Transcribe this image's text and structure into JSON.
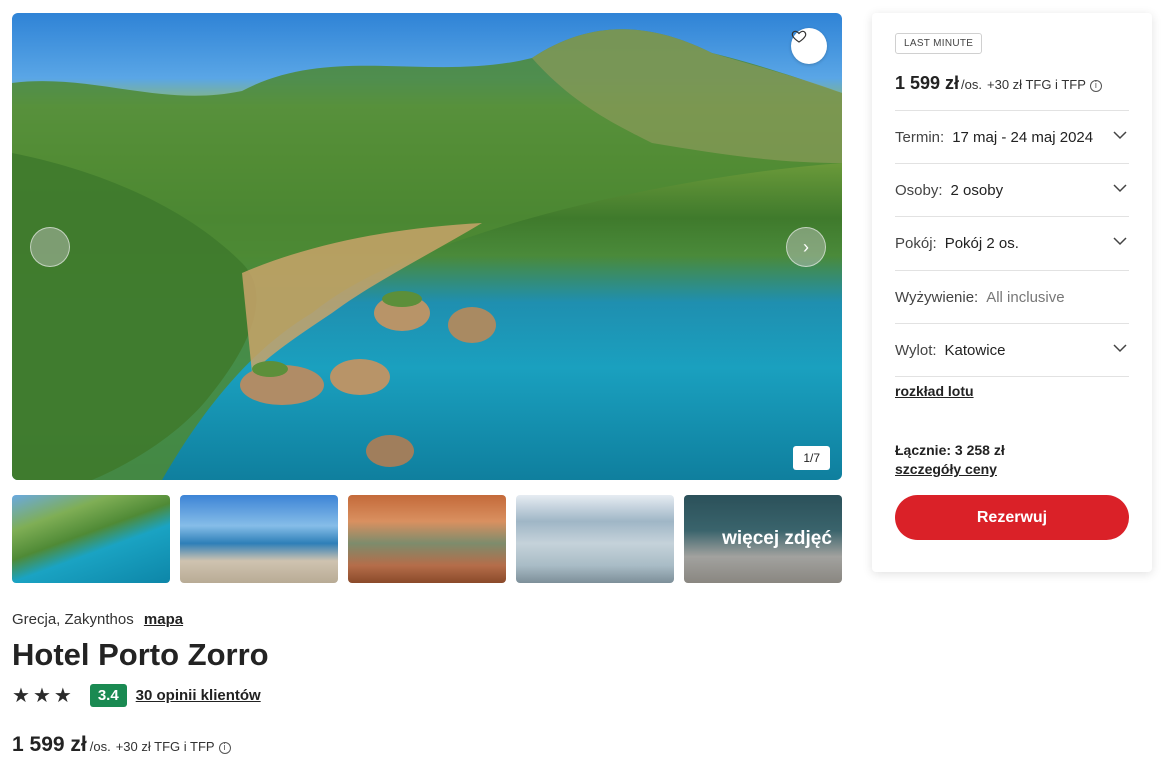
{
  "gallery": {
    "counter": "1/7",
    "more_photos_label": "więcej zdjęć"
  },
  "hotel": {
    "location": "Grecja, Zakynthos",
    "map_link": "mapa",
    "name": "Hotel Porto Zorro",
    "stars": 3,
    "score": "3.4",
    "reviews_link": "30 opinii klientów",
    "price": "1 599 zł",
    "price_unit": "/os.",
    "price_extra": "+30 zł TFG i TFP"
  },
  "booking": {
    "badge": "LAST MINUTE",
    "price": "1 599 zł",
    "price_unit": "/os.",
    "price_extra": "+30 zł TFG i TFP",
    "term_label": "Termin:",
    "term_value": "17 maj - 24 maj 2024",
    "persons_label": "Osoby:",
    "persons_value": "2 osoby",
    "room_label": "Pokój:",
    "room_value": "Pokój 2 os.",
    "board_label": "Wyżywienie:",
    "board_value": "All inclusive",
    "departure_label": "Wylot:",
    "departure_value": "Katowice",
    "flight_schedule_link": "rozkład lotu",
    "total": "Łącznie: 3 258 zł",
    "price_details_link": "szczegóły ceny",
    "book_button": "Rezerwuj"
  },
  "colors": {
    "accent_red": "#da2128",
    "score_green": "#1a8a52"
  }
}
